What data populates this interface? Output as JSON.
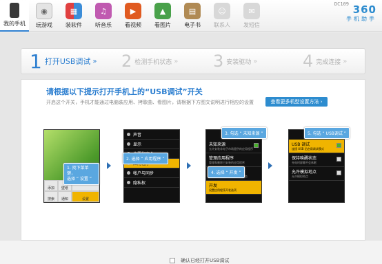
{
  "toolbar": {
    "items": [
      {
        "label": "我的手机",
        "icon": "phone-icon",
        "color": "#3a3a3a"
      },
      {
        "label": "玩游戏",
        "icon": "gamepad-icon",
        "color": "#8c8c8c"
      },
      {
        "label": "装软件",
        "icon": "apps-icon",
        "color": "#e04040"
      },
      {
        "label": "听音乐",
        "icon": "music-icon",
        "color": "#c05ab0"
      },
      {
        "label": "看视频",
        "icon": "video-icon",
        "color": "#e05a20"
      },
      {
        "label": "看图片",
        "icon": "picture-icon",
        "color": "#49a14a"
      },
      {
        "label": "电子书",
        "icon": "ebook-icon",
        "color": "#b08a54"
      },
      {
        "label": "联系人",
        "icon": "contacts-icon",
        "color": "#c8c8c8"
      },
      {
        "label": "发短信",
        "icon": "sms-icon",
        "color": "#c8c8c8"
      }
    ],
    "brand_number": "360",
    "brand_name": "手机助手",
    "device_code": "DC109"
  },
  "steps": [
    {
      "num": "1",
      "label": "打开USB调试",
      "arrow": "»"
    },
    {
      "num": "2",
      "label": "检测手机状态",
      "arrow": "»"
    },
    {
      "num": "3",
      "label": "安装驱动",
      "arrow": "»"
    },
    {
      "num": "4",
      "label": "完成连接",
      "arrow": "»"
    }
  ],
  "panel": {
    "title": "请根据以下提示打开手机上的“USB调试”开关",
    "description": "开启这个开关，手机才能通过电脑装应用、拷歌曲、看图片，请根据下方图文说明进行相应的设置",
    "more_button": "查看更多机型设置方法 ›"
  },
  "phone1": {
    "cells": [
      "添加",
      "壁纸",
      "搜索",
      "通知",
      "设置"
    ],
    "callout": "1. 找下菜单键，\n选择 “ 设置 ”"
  },
  "phone2": {
    "items": [
      "声音",
      "显示",
      "位置和安全",
      "应用程序",
      "帐户与同步",
      "隐私权"
    ],
    "callout": "2. 选择 “ 应用程序 ”"
  },
  "phone3": {
    "options": [
      {
        "title": "未知来源",
        "desc": "允许安装非电子市场提供的应用程序"
      },
      {
        "title": "管理应用程序",
        "desc": "管理和删除已安装的应用程序"
      },
      {
        "title": "正在运行的服务",
        "desc": "查看和控制当前正在运行的服务"
      },
      {
        "title": "开发",
        "desc": "设置应用程序开发选项"
      }
    ],
    "callout_top": "3. 勾选 “ 未知来源 ”",
    "callout_mid": "4. 选择 “ 开发 ”"
  },
  "phone4": {
    "options": [
      {
        "title": "USB 调试",
        "desc": "连接 USB 后启用调试模式"
      },
      {
        "title": "保持唤醒状态",
        "desc": "充电时屏幕不会休眠"
      },
      {
        "title": "允许模拟地点",
        "desc": "允许模拟地点"
      }
    ],
    "callout": "5. 勾选 “ USB调试 ”"
  },
  "confirm_label": "确认已经打开USB调试"
}
